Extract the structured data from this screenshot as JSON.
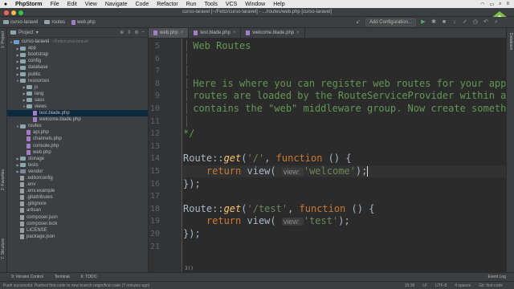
{
  "menubar": {
    "app": "PhpStorm",
    "items": [
      "File",
      "Edit",
      "View",
      "Navigate",
      "Code",
      "Refactor",
      "Run",
      "Tools",
      "VCS",
      "Window",
      "Help"
    ]
  },
  "window": {
    "title": "curso-laravel [~/Fettz/curso-laravel] - .../routes/web.php [curso-laravel]"
  },
  "navbar": {
    "crumbs": [
      "curso-laravel",
      "routes",
      "web.php"
    ],
    "config_label": "Add Configuration..."
  },
  "left_tabs": [
    "1: Project",
    "2: Favorites",
    "7: Structure"
  ],
  "project": {
    "title": "Project",
    "tree": [
      {
        "label": "curso-laravel",
        "hint": "~/Fettz/curso-laravel",
        "indent": 0,
        "arrow": "▼",
        "icon": "folder-blue"
      },
      {
        "label": "app",
        "indent": 1,
        "arrow": "▶",
        "icon": "folder"
      },
      {
        "label": "bootstrap",
        "indent": 1,
        "arrow": "▶",
        "icon": "folder"
      },
      {
        "label": "config",
        "indent": 1,
        "arrow": "▶",
        "icon": "folder"
      },
      {
        "label": "database",
        "indent": 1,
        "arrow": "▶",
        "icon": "folder"
      },
      {
        "label": "public",
        "indent": 1,
        "arrow": "▶",
        "icon": "folder"
      },
      {
        "label": "resources",
        "indent": 1,
        "arrow": "▼",
        "icon": "folder"
      },
      {
        "label": "js",
        "indent": 2,
        "arrow": "▶",
        "icon": "folder"
      },
      {
        "label": "lang",
        "indent": 2,
        "arrow": "▶",
        "icon": "folder"
      },
      {
        "label": "sass",
        "indent": 2,
        "arrow": "▶",
        "icon": "folder"
      },
      {
        "label": "views",
        "indent": 2,
        "arrow": "▼",
        "icon": "folder"
      },
      {
        "label": "test.blade.php",
        "indent": 3,
        "arrow": "",
        "icon": "php",
        "selected": true
      },
      {
        "label": "welcome.blade.php",
        "indent": 3,
        "arrow": "",
        "icon": "php"
      },
      {
        "label": "routes",
        "indent": 1,
        "arrow": "▼",
        "icon": "folder"
      },
      {
        "label": "api.php",
        "indent": 2,
        "arrow": "",
        "icon": "php"
      },
      {
        "label": "channels.php",
        "indent": 2,
        "arrow": "",
        "icon": "php"
      },
      {
        "label": "console.php",
        "indent": 2,
        "arrow": "",
        "icon": "php"
      },
      {
        "label": "web.php",
        "indent": 2,
        "arrow": "",
        "icon": "php"
      },
      {
        "label": "storage",
        "indent": 1,
        "arrow": "▶",
        "icon": "folder"
      },
      {
        "label": "tests",
        "indent": 1,
        "arrow": "▶",
        "icon": "folder"
      },
      {
        "label": "vendor",
        "indent": 1,
        "arrow": "▶",
        "icon": "lib"
      },
      {
        "label": ".editorconfig",
        "indent": 1,
        "arrow": "",
        "icon": "file"
      },
      {
        "label": ".env",
        "indent": 1,
        "arrow": "",
        "icon": "file"
      },
      {
        "label": ".env.example",
        "indent": 1,
        "arrow": "",
        "icon": "file"
      },
      {
        "label": ".gitattributes",
        "indent": 1,
        "arrow": "",
        "icon": "file"
      },
      {
        "label": ".gitignore",
        "indent": 1,
        "arrow": "",
        "icon": "file"
      },
      {
        "label": "artisan",
        "indent": 1,
        "arrow": "",
        "icon": "file"
      },
      {
        "label": "composer.json",
        "indent": 1,
        "arrow": "",
        "icon": "file"
      },
      {
        "label": "composer.lock",
        "indent": 1,
        "arrow": "",
        "icon": "file"
      },
      {
        "label": "LICENSE",
        "indent": 1,
        "arrow": "",
        "icon": "file"
      },
      {
        "label": "package.json",
        "indent": 1,
        "arrow": "",
        "icon": "file"
      }
    ]
  },
  "tabs": [
    {
      "label": "web.php",
      "active": true
    },
    {
      "label": "test.blade.php",
      "active": false
    },
    {
      "label": "welcome.blade.php",
      "active": false
    }
  ],
  "code": {
    "lines": [
      {
        "n": "5",
        "text": "Web Routes"
      },
      {
        "n": "6",
        "text": ""
      },
      {
        "n": "7",
        "text": ""
      },
      {
        "n": "8",
        "text": "Here is where you can register web routes for your applicati"
      },
      {
        "n": "9",
        "text": "routes are loaded by the RouteServiceProvider within a grou"
      },
      {
        "n": "10",
        "text": "contains the \"web\" middleware group. Now create something gr"
      },
      {
        "n": "11",
        "text": ""
      },
      {
        "n": "12",
        "text": "*/"
      },
      {
        "n": "13",
        "text": ""
      },
      {
        "n": "14",
        "text": "Route::get('/', function () {"
      },
      {
        "n": "15",
        "text": "    return view( view: 'welcome');"
      },
      {
        "n": "16",
        "text": "});"
      },
      {
        "n": "17",
        "text": ""
      },
      {
        "n": "18",
        "text": "Route::get('/test', function () {"
      },
      {
        "n": "19",
        "text": "    return view( view: 'test');"
      },
      {
        "n": "20",
        "text": "});"
      },
      {
        "n": "21",
        "text": ""
      }
    ],
    "status_hint": "3()"
  },
  "right_tabs": [
    "Database"
  ],
  "bottom": {
    "tabs": [
      "9: Version Control",
      "Terminal",
      "6: TODO"
    ],
    "event_log": "Event Log"
  },
  "status": {
    "message": "Push successful: Pushed first-code to new branch origin/first-code (7 minutes ago)",
    "position": "15:38",
    "lf": "LF",
    "encoding": "UTF-8",
    "indent": "4 spaces",
    "git": "Git: first-code"
  }
}
